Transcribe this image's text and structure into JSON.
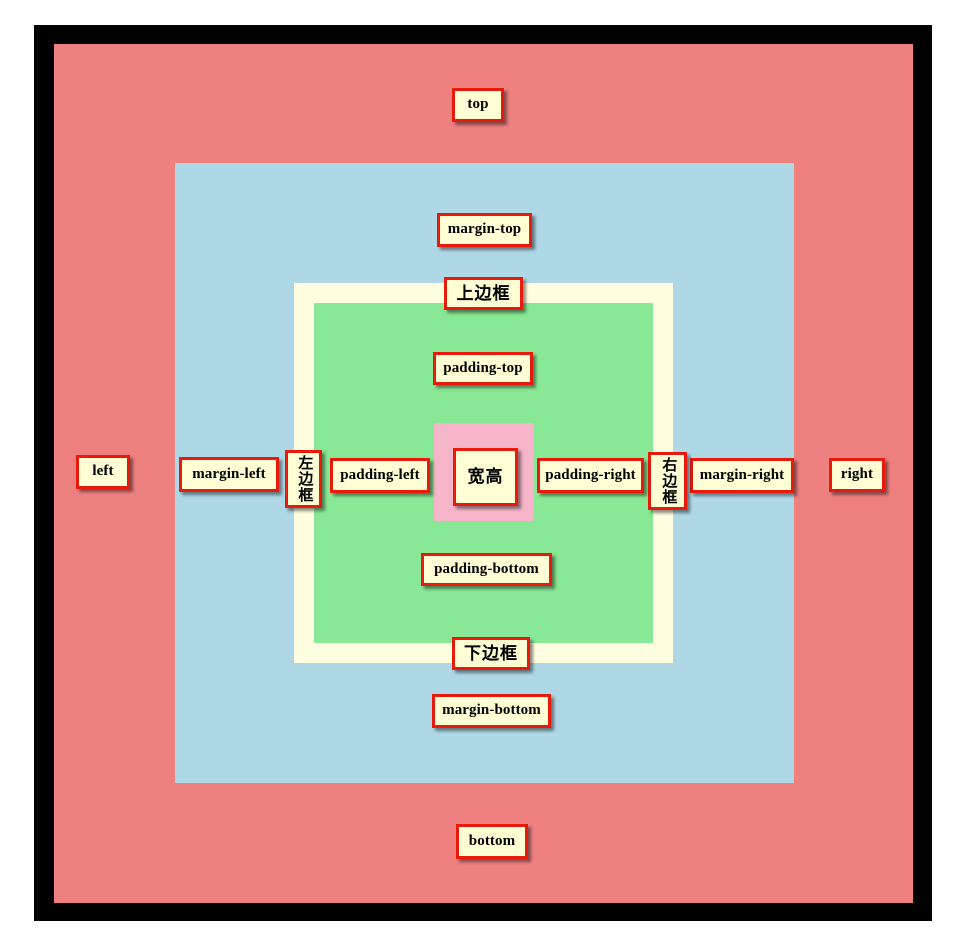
{
  "diagram": {
    "title": "CSS Box Model Diagram",
    "layers": {
      "frame": {
        "name": "outer-frame",
        "color": "#000000"
      },
      "margin": {
        "name": "margin-area",
        "color": "#ef8080"
      },
      "border_outer": {
        "name": "border-box-area",
        "color": "#aed8e6"
      },
      "border_band": {
        "name": "border-band",
        "color": "#fffee0"
      },
      "padding": {
        "name": "padding-area",
        "color": "#88e895"
      },
      "content": {
        "name": "content-area",
        "color": "#f6b5c8"
      }
    },
    "label_style": {
      "background": "#fffed5",
      "border_color": "#e81a0c"
    },
    "labels": {
      "top": "top",
      "bottom": "bottom",
      "left": "left",
      "right": "right",
      "margin_top": "margin-top",
      "margin_bottom": "margin-bottom",
      "margin_left": "margin-left",
      "margin_right": "margin-right",
      "border_top": "上边框",
      "border_bottom": "下边框",
      "border_left": "左边框",
      "border_right": "右边框",
      "padding_top": "padding-top",
      "padding_bottom": "padding-bottom",
      "padding_left": "padding-left",
      "padding_right": "padding-right",
      "content": "宽高"
    }
  }
}
